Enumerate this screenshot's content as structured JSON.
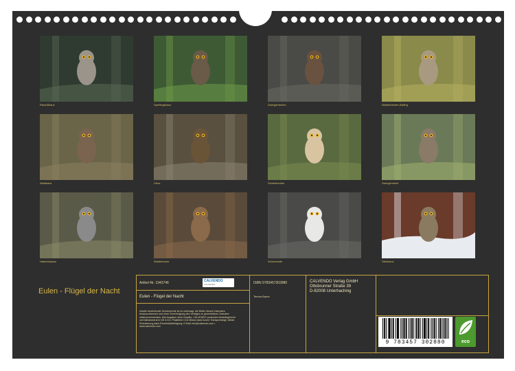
{
  "colors": {
    "board": "#2e2e2e",
    "caption": "#d9c36a",
    "frame": "#c9a640",
    "eco_green": "#4d9a2e"
  },
  "photos": [
    {
      "caption": "Raufußkauz",
      "bg": "#2f3a30",
      "accent": "#5a6a55",
      "owl": "#9a948a"
    },
    {
      "caption": "Sperlingskauz",
      "bg": "#3d5a35",
      "accent": "#6f9a48",
      "owl": "#6a5a48"
    },
    {
      "caption": "Zwergohreulen",
      "bg": "#4a4a46",
      "accent": "#6a6a64",
      "owl": "#6a5240"
    },
    {
      "caption": "Waldohreulen-Ästling",
      "bg": "#8a8a4a",
      "accent": "#b5b060",
      "owl": "#a89a80"
    },
    {
      "caption": "Waldkauz",
      "bg": "#6a6448",
      "accent": "#8a8060",
      "owl": "#7a6450"
    },
    {
      "caption": "Uhus",
      "bg": "#5a5040",
      "accent": "#8a8470",
      "owl": "#6a5438"
    },
    {
      "caption": "Schleiereulen",
      "bg": "#5a6a40",
      "accent": "#7a8a50",
      "owl": "#d8c4a0"
    },
    {
      "caption": "Zwergohreule",
      "bg": "#6a7a58",
      "accent": "#a0b070",
      "owl": "#8a7a68"
    },
    {
      "caption": "Habichtskauz",
      "bg": "#5a5a48",
      "accent": "#8a8a6a",
      "owl": "#8a8a8a"
    },
    {
      "caption": "Waldohreule",
      "bg": "#5a4a3a",
      "accent": "#8a6a4a",
      "owl": "#8a6a4a"
    },
    {
      "caption": "Schneeeule",
      "bg": "#4a4a48",
      "accent": "#6a6a66",
      "owl": "#e8e8e6"
    },
    {
      "caption": "Steinkauz",
      "bg": "#6a3a2a",
      "accent": "#e8ecf0",
      "owl": "#8a7a60"
    }
  ],
  "cover_title": "Eulen - Flügel der Nacht",
  "info": {
    "article_no": "Artikel-Nr. 1943746",
    "title": "Eulen - Flügel der Nacht",
    "legal": "Inhalte bestehender Schutzrechte ist es untersagt, die Bilder dieses Kalenders herauszutrennen und ohne Genehmigung des Verlages zu gewerblichen Zwecken weiterzuverwenden. Alle Angaben ohne Gewähr. CALVENDO produziert bedarfsgerecht und klimaneutral in DE & EU. Plastikfrei CO2-Bilanz dank kurzer Transportwege. Abfall-Reduzierung dank Einzelstückfertigung. E-Mail: info@calvendo.com • www.calvendo.com",
    "isbn": "ISBN 9783457302880",
    "author": "Teresa Bauer",
    "publisher_name": "CALVENDO Verlag GmbH",
    "publisher_street": "Ottobrunner Straße 39",
    "publisher_city": "D-82008 Unterhaching",
    "logo_text": "CALVENDO",
    "logo_sub": "CALVENDO",
    "barcode_digits": "9 783457 302880",
    "eco_label": "eco"
  }
}
